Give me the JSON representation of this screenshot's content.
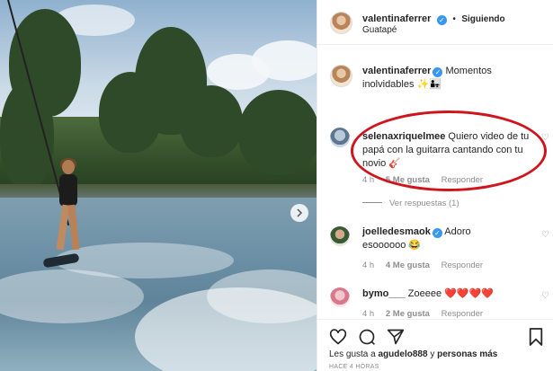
{
  "post": {
    "author": "valentinaferrer",
    "separator": "•",
    "follow_status": "Siguiendo",
    "location": "Guatapé"
  },
  "caption": {
    "username": "valentinaferrer",
    "text": "Momentos inolvidables ✨👨‍👧"
  },
  "comments": [
    {
      "username": "selenaxriquelmee",
      "text": "Quiero video de tu papá con la guitarra cantando con tu novio 🎸",
      "time": "4 h",
      "likes": "5 Me gusta",
      "reply": "Responder",
      "view_replies": "Ver respuestas (1)"
    },
    {
      "username": "joelledesmaok",
      "text": "Adoro esoooooo 😂",
      "time": "4 h",
      "likes": "4 Me gusta",
      "reply": "Responder"
    },
    {
      "username": "bymo___",
      "text": "Zoeeee ❤️❤️❤️❤️",
      "time": "4 h",
      "likes": "2 Me gusta",
      "reply": "Responder"
    }
  ],
  "likes_line": {
    "prefix": "Les gusta a",
    "user": "agudelo888",
    "middle": "y",
    "rest": "personas más"
  },
  "date_text": "HACE 4 HORAS",
  "colors": {
    "highlight": "#d0141c",
    "verified": "#3897f0",
    "link": "#262626",
    "muted": "#8e8e8e"
  },
  "icons": {
    "like": "heart-icon",
    "comment": "comment-icon",
    "share": "paper-plane-icon",
    "save": "bookmark-icon",
    "next": "chevron-right-icon"
  }
}
